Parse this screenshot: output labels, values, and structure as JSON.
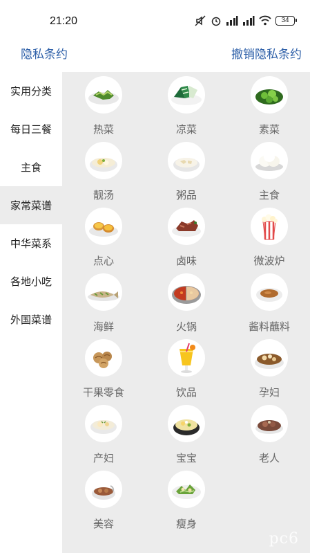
{
  "status_bar": {
    "time": "21:20",
    "battery": "34"
  },
  "header": {
    "left_link": "隐私条约",
    "right_link": "撤销隐私条约"
  },
  "sidebar": {
    "items": [
      {
        "label": "实用分类",
        "active": false
      },
      {
        "label": "每日三餐",
        "active": false
      },
      {
        "label": "主食",
        "active": false
      },
      {
        "label": "家常菜谱",
        "active": true
      },
      {
        "label": "中华菜系",
        "active": false
      },
      {
        "label": "各地小吃",
        "active": false
      },
      {
        "label": "外国菜谱",
        "active": false
      }
    ]
  },
  "categories": [
    {
      "label": "热菜",
      "icon": "stir-fry-dish-icon"
    },
    {
      "label": "凉菜",
      "icon": "cold-dish-icon"
    },
    {
      "label": "素菜",
      "icon": "vegetable-dish-icon"
    },
    {
      "label": "靓汤",
      "icon": "soup-icon"
    },
    {
      "label": "粥品",
      "icon": "congee-icon"
    },
    {
      "label": "主食",
      "icon": "steamed-bun-icon"
    },
    {
      "label": "点心",
      "icon": "egg-tart-icon"
    },
    {
      "label": "卤味",
      "icon": "braised-meat-icon"
    },
    {
      "label": "微波炉",
      "icon": "popcorn-icon"
    },
    {
      "label": "海鲜",
      "icon": "fish-icon"
    },
    {
      "label": "火锅",
      "icon": "hotpot-icon"
    },
    {
      "label": "酱料蘸料",
      "icon": "sauce-icon"
    },
    {
      "label": "干果零食",
      "icon": "walnut-icon"
    },
    {
      "label": "饮品",
      "icon": "drink-icon"
    },
    {
      "label": "孕妇",
      "icon": "pregnancy-meal-icon"
    },
    {
      "label": "产妇",
      "icon": "postpartum-soup-icon"
    },
    {
      "label": "宝宝",
      "icon": "baby-food-icon"
    },
    {
      "label": "老人",
      "icon": "elderly-meal-icon"
    },
    {
      "label": "美容",
      "icon": "beauty-soup-icon"
    },
    {
      "label": "瘦身",
      "icon": "slimming-salad-icon"
    }
  ],
  "watermark": "pc6"
}
